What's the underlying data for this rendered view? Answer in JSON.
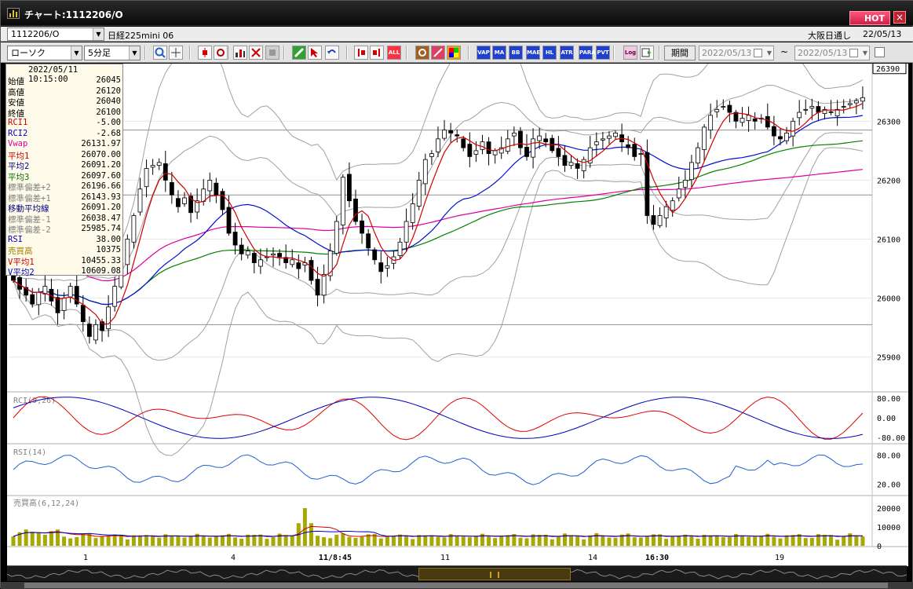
{
  "window": {
    "title": "チャート:1112206/O",
    "hot_label": "HOT",
    "close_label": "×"
  },
  "symbol_bar": {
    "symbol": "1112206/O",
    "name": "日経225mini 06",
    "exchange": "大阪日通し",
    "date": "22/05/13"
  },
  "toolbar": {
    "chart_type": "ローソク",
    "interval": "5分足",
    "period_label": "期間",
    "date_from": "2022/05/13",
    "date_to": "2022/05/13",
    "range_sep": "~",
    "icons": [
      "zoom-icon",
      "cursor-icon",
      "candle-icon",
      "drawing-icon",
      "volume-bar-icon",
      "cross-icon",
      "disabled-icon",
      "pencil-icon",
      "arrow-pointer-icon",
      "undo-icon",
      "bar-left-icon",
      "bar-right-icon",
      "all-icon",
      "settings-icon",
      "pen-icon",
      "palette-icon",
      "vap-icon",
      "ma-icon",
      "bb-icon",
      "mae-icon",
      "hl-icon",
      "atr-icon",
      "para-icon",
      "pvt-icon",
      "log-icon",
      "export-icon"
    ],
    "labels": {
      "all": "ALL",
      "ma": "MA",
      "bb": "BB",
      "mae": "MAE",
      "hl": "HL",
      "atr": "ATR",
      "para": "PARA",
      "pvt": "PVT",
      "log": "Log",
      "vap": "VAP"
    }
  },
  "info_panel": {
    "datetime": "2022/05/11  10:15:00",
    "rows": [
      {
        "k": "始値",
        "v": "26045",
        "color": "#000000"
      },
      {
        "k": "高値",
        "v": "26120",
        "color": "#000000"
      },
      {
        "k": "安値",
        "v": "26040",
        "color": "#000000"
      },
      {
        "k": "終値",
        "v": "26100",
        "color": "#000000"
      },
      {
        "k": "RCI1",
        "v": "-5.00",
        "color": "#d00000"
      },
      {
        "k": "RCI2",
        "v": "-2.68",
        "color": "#0000c0"
      },
      {
        "k": "Vwap",
        "v": "26131.97",
        "color": "#e000a0"
      },
      {
        "k": "平均1",
        "v": "26070.00",
        "color": "#d00000"
      },
      {
        "k": "平均2",
        "v": "26091.20",
        "color": "#000090"
      },
      {
        "k": "平均3",
        "v": "26097.60",
        "color": "#007000"
      },
      {
        "k": "標準偏差+2",
        "v": "26196.66",
        "color": "#808080"
      },
      {
        "k": "標準偏差+1",
        "v": "26143.93",
        "color": "#808080"
      },
      {
        "k": "移動平均線",
        "v": "26091.20",
        "color": "#000080"
      },
      {
        "k": "標準偏差-1",
        "v": "26038.47",
        "color": "#808080"
      },
      {
        "k": "標準偏差-2",
        "v": "25985.74",
        "color": "#808080"
      },
      {
        "k": "RSI",
        "v": "38.00",
        "color": "#0000c0"
      },
      {
        "k": "売買高",
        "v": "10375",
        "color": "#a08000"
      },
      {
        "k": "V平均1",
        "v": "10455.33",
        "color": "#d00000"
      },
      {
        "k": "V平均2",
        "v": "10609.08",
        "color": "#0000c0"
      }
    ]
  },
  "price_axis": {
    "ticks": [
      "26300",
      "26200",
      "26100",
      "26000",
      "25900"
    ],
    "last": "26390"
  },
  "panes": {
    "rci": {
      "label": "RCI(9,26)",
      "ticks": [
        "80.00",
        "0.00",
        "-80.00"
      ]
    },
    "rsi": {
      "label": "RSI(14)",
      "ticks": [
        "80.00",
        "20.00"
      ]
    },
    "vol": {
      "label": "売買高(6,12,24)",
      "ticks": [
        "20000",
        "10000",
        "0"
      ]
    }
  },
  "time_axis": {
    "labels": [
      "1",
      "4",
      "11/8:45",
      "11",
      "14",
      "16:30",
      "19"
    ]
  },
  "colors": {
    "up": "#ffffff",
    "down": "#000000",
    "ma1": "#d00000",
    "ma2": "#0010d0",
    "ma3": "#008000",
    "vwap": "#e000a0",
    "band": "#a0a0a0",
    "vol": "#a8a800"
  },
  "chart_data": {
    "type": "candlestick",
    "title": "",
    "ylim": [
      25845,
      26395
    ],
    "close": [
      26030,
      26015,
      26005,
      25990,
      26010,
      26020,
      25995,
      25975,
      26000,
      26020,
      25990,
      25960,
      25935,
      25955,
      25945,
      25985,
      26020,
      26060,
      26100,
      26140,
      26185,
      26220,
      26225,
      26230,
      26200,
      26175,
      26155,
      26170,
      26145,
      26165,
      26185,
      26200,
      26175,
      26150,
      26110,
      26090,
      26075,
      26080,
      26060,
      26065,
      26070,
      26075,
      26070,
      26060,
      26065,
      26050,
      26060,
      26030,
      26005,
      26040,
      26080,
      26130,
      26205,
      26165,
      26130,
      26110,
      26085,
      26065,
      26045,
      26055,
      26070,
      26095,
      26130,
      26160,
      26200,
      26235,
      26245,
      26270,
      26285,
      26280,
      26275,
      26255,
      26240,
      26250,
      26265,
      26245,
      26250,
      26255,
      26270,
      26280,
      26255,
      26240,
      26270,
      26275,
      26265,
      26250,
      26240,
      26225,
      26230,
      26220,
      26235,
      26255,
      26265,
      26270,
      26275,
      26280,
      26265,
      26255,
      26240,
      26245,
      26140,
      26125,
      26140,
      26155,
      26165,
      26185,
      26200,
      26230,
      26255,
      26290,
      26310,
      26320,
      26325,
      26315,
      26300,
      26305,
      26310,
      26300,
      26305,
      26290,
      26275,
      26270,
      26280,
      26300,
      26315,
      26320,
      26325,
      26315,
      26320,
      26315,
      26320,
      26325,
      26330,
      26335,
      26340
    ],
    "rsi_desc": "oscillating 20-80",
    "volume_peak": 20000
  }
}
